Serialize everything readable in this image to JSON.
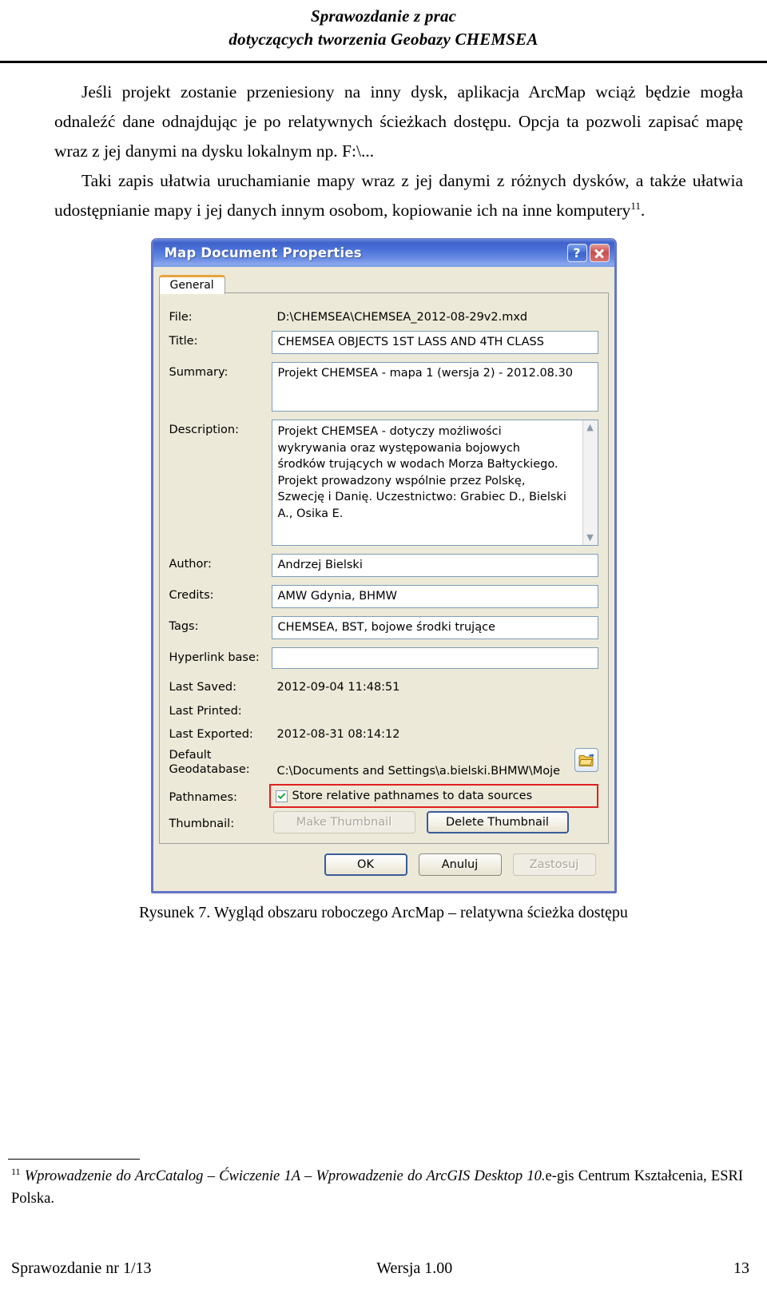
{
  "header": {
    "line1": "Sprawozdanie z prac",
    "line2": "dotyczących tworzenia Geobazy CHEMSEA"
  },
  "body": {
    "para1": "Jeśli projekt zostanie przeniesiony na inny dysk, aplikacja ArcMap wciąż będzie mogła odnaleźć dane odnajdując je po relatywnych ścieżkach dostępu. Opcja ta pozwoli zapisać mapę wraz z jej danymi na dysku lokalnym np. F:\\...",
    "para2_text": "Taki zapis ułatwia uruchamianie mapy wraz z jej danymi z różnych dysków, a także ułatwia udostępnianie mapy i jej danych innym osobom, kopiowanie ich na inne komputery",
    "para2_footnote_ref": "11",
    "para2_tail": "."
  },
  "dialog": {
    "title": "Map Document Properties",
    "help_button": "?",
    "close_button": "×",
    "tab_general": "General",
    "labels": {
      "file": "File:",
      "title": "Title:",
      "summary": "Summary:",
      "description": "Description:",
      "author": "Author:",
      "credits": "Credits:",
      "tags": "Tags:",
      "hyperlink_base": "Hyperlink base:",
      "last_saved": "Last Saved:",
      "last_printed": "Last Printed:",
      "last_exported": "Last Exported:",
      "default_geodatabase_l1": "Default",
      "default_geodatabase_l2": "Geodatabase:",
      "pathnames": "Pathnames:",
      "thumbnail": "Thumbnail:"
    },
    "values": {
      "file": "D:\\CHEMSEA\\CHEMSEA_2012-08-29v2.mxd",
      "title": "CHEMSEA OBJECTS 1ST LASS AND 4TH CLASS",
      "summary": "Projekt CHEMSEA - mapa 1 (wersja 2) - 2012.08.30",
      "description": "Projekt CHEMSEA - dotyczy możliwości\nwykrywania oraz występowania bojowych\nśrodków trujących w wodach Morza Bałtyckiego.\nProjekt prowadzony wspólnie przez Polskę,\nSzwecję i Danię. Uczestnictwo: Grabiec D., Bielski\nA., Osika E.",
      "author": "Andrzej Bielski",
      "credits": "AMW Gdynia, BHMW",
      "tags": "CHEMSEA, BST, bojowe środki trujące",
      "hyperlink_base": "",
      "last_saved": "2012-09-04 11:48:51",
      "last_printed": "",
      "last_exported": "2012-08-31 08:14:12",
      "default_geodatabase": "C:\\Documents and Settings\\a.bielski.BHMW\\Moje"
    },
    "checkbox_pathnames_label": "Store relative pathnames to data sources",
    "checkbox_pathnames_checked": true,
    "buttons": {
      "make_thumbnail": "Make Thumbnail",
      "delete_thumbnail": "Delete Thumbnail",
      "ok": "OK",
      "cancel": "Anuluj",
      "apply": "Zastosuj"
    },
    "colors": {
      "titlebar_blue": "#3f62cb",
      "dialog_face": "#ece9d8",
      "highlight_red": "#e02020",
      "tab_accent_orange": "#e9a33a",
      "check_green": "#1f9f3d",
      "folder_yellow": "#f5c342"
    }
  },
  "caption": "Rysunek 7. Wygląd obszaru roboczego ArcMap – relatywna ścieżka dostępu",
  "footnote": {
    "ref": "11",
    "italic_part": "Wprowadzenie do ArcCatalog – Ćwiczenie 1A – Wprowadzenie do ArcGIS Desktop 10.",
    "plain_part": "e-gis Centrum Kształcenia, ESRI Polska."
  },
  "page_footer": {
    "left": "Sprawozdanie nr 1/13",
    "center": "Wersja 1.00",
    "right": "13"
  }
}
